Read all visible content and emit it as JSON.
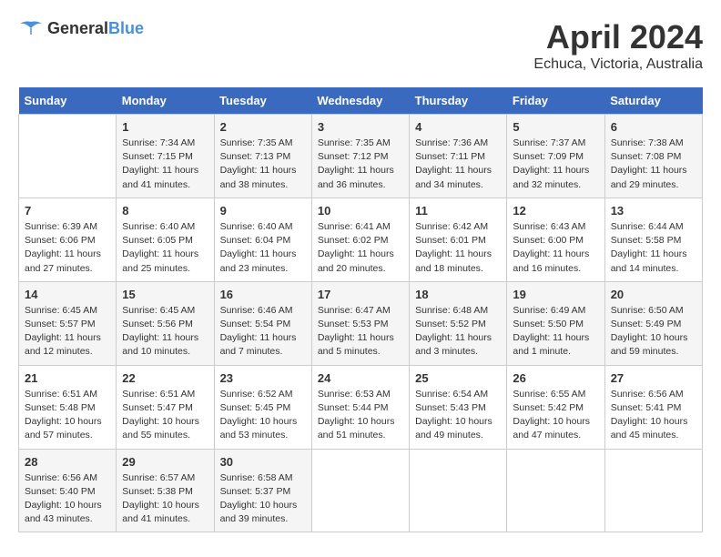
{
  "header": {
    "logo": {
      "text_general": "General",
      "text_blue": "Blue"
    },
    "month": "April 2024",
    "location": "Echuca, Victoria, Australia"
  },
  "weekdays": [
    "Sunday",
    "Monday",
    "Tuesday",
    "Wednesday",
    "Thursday",
    "Friday",
    "Saturday"
  ],
  "weeks": [
    [
      {
        "day": "",
        "info": ""
      },
      {
        "day": "1",
        "info": "Sunrise: 7:34 AM\nSunset: 7:15 PM\nDaylight: 11 hours\nand 41 minutes."
      },
      {
        "day": "2",
        "info": "Sunrise: 7:35 AM\nSunset: 7:13 PM\nDaylight: 11 hours\nand 38 minutes."
      },
      {
        "day": "3",
        "info": "Sunrise: 7:35 AM\nSunset: 7:12 PM\nDaylight: 11 hours\nand 36 minutes."
      },
      {
        "day": "4",
        "info": "Sunrise: 7:36 AM\nSunset: 7:11 PM\nDaylight: 11 hours\nand 34 minutes."
      },
      {
        "day": "5",
        "info": "Sunrise: 7:37 AM\nSunset: 7:09 PM\nDaylight: 11 hours\nand 32 minutes."
      },
      {
        "day": "6",
        "info": "Sunrise: 7:38 AM\nSunset: 7:08 PM\nDaylight: 11 hours\nand 29 minutes."
      }
    ],
    [
      {
        "day": "7",
        "info": "Sunrise: 6:39 AM\nSunset: 6:06 PM\nDaylight: 11 hours\nand 27 minutes."
      },
      {
        "day": "8",
        "info": "Sunrise: 6:40 AM\nSunset: 6:05 PM\nDaylight: 11 hours\nand 25 minutes."
      },
      {
        "day": "9",
        "info": "Sunrise: 6:40 AM\nSunset: 6:04 PM\nDaylight: 11 hours\nand 23 minutes."
      },
      {
        "day": "10",
        "info": "Sunrise: 6:41 AM\nSunset: 6:02 PM\nDaylight: 11 hours\nand 20 minutes."
      },
      {
        "day": "11",
        "info": "Sunrise: 6:42 AM\nSunset: 6:01 PM\nDaylight: 11 hours\nand 18 minutes."
      },
      {
        "day": "12",
        "info": "Sunrise: 6:43 AM\nSunset: 6:00 PM\nDaylight: 11 hours\nand 16 minutes."
      },
      {
        "day": "13",
        "info": "Sunrise: 6:44 AM\nSunset: 5:58 PM\nDaylight: 11 hours\nand 14 minutes."
      }
    ],
    [
      {
        "day": "14",
        "info": "Sunrise: 6:45 AM\nSunset: 5:57 PM\nDaylight: 11 hours\nand 12 minutes."
      },
      {
        "day": "15",
        "info": "Sunrise: 6:45 AM\nSunset: 5:56 PM\nDaylight: 11 hours\nand 10 minutes."
      },
      {
        "day": "16",
        "info": "Sunrise: 6:46 AM\nSunset: 5:54 PM\nDaylight: 11 hours\nand 7 minutes."
      },
      {
        "day": "17",
        "info": "Sunrise: 6:47 AM\nSunset: 5:53 PM\nDaylight: 11 hours\nand 5 minutes."
      },
      {
        "day": "18",
        "info": "Sunrise: 6:48 AM\nSunset: 5:52 PM\nDaylight: 11 hours\nand 3 minutes."
      },
      {
        "day": "19",
        "info": "Sunrise: 6:49 AM\nSunset: 5:50 PM\nDaylight: 11 hours\nand 1 minute."
      },
      {
        "day": "20",
        "info": "Sunrise: 6:50 AM\nSunset: 5:49 PM\nDaylight: 10 hours\nand 59 minutes."
      }
    ],
    [
      {
        "day": "21",
        "info": "Sunrise: 6:51 AM\nSunset: 5:48 PM\nDaylight: 10 hours\nand 57 minutes."
      },
      {
        "day": "22",
        "info": "Sunrise: 6:51 AM\nSunset: 5:47 PM\nDaylight: 10 hours\nand 55 minutes."
      },
      {
        "day": "23",
        "info": "Sunrise: 6:52 AM\nSunset: 5:45 PM\nDaylight: 10 hours\nand 53 minutes."
      },
      {
        "day": "24",
        "info": "Sunrise: 6:53 AM\nSunset: 5:44 PM\nDaylight: 10 hours\nand 51 minutes."
      },
      {
        "day": "25",
        "info": "Sunrise: 6:54 AM\nSunset: 5:43 PM\nDaylight: 10 hours\nand 49 minutes."
      },
      {
        "day": "26",
        "info": "Sunrise: 6:55 AM\nSunset: 5:42 PM\nDaylight: 10 hours\nand 47 minutes."
      },
      {
        "day": "27",
        "info": "Sunrise: 6:56 AM\nSunset: 5:41 PM\nDaylight: 10 hours\nand 45 minutes."
      }
    ],
    [
      {
        "day": "28",
        "info": "Sunrise: 6:56 AM\nSunset: 5:40 PM\nDaylight: 10 hours\nand 43 minutes."
      },
      {
        "day": "29",
        "info": "Sunrise: 6:57 AM\nSunset: 5:38 PM\nDaylight: 10 hours\nand 41 minutes."
      },
      {
        "day": "30",
        "info": "Sunrise: 6:58 AM\nSunset: 5:37 PM\nDaylight: 10 hours\nand 39 minutes."
      },
      {
        "day": "",
        "info": ""
      },
      {
        "day": "",
        "info": ""
      },
      {
        "day": "",
        "info": ""
      },
      {
        "day": "",
        "info": ""
      }
    ]
  ]
}
